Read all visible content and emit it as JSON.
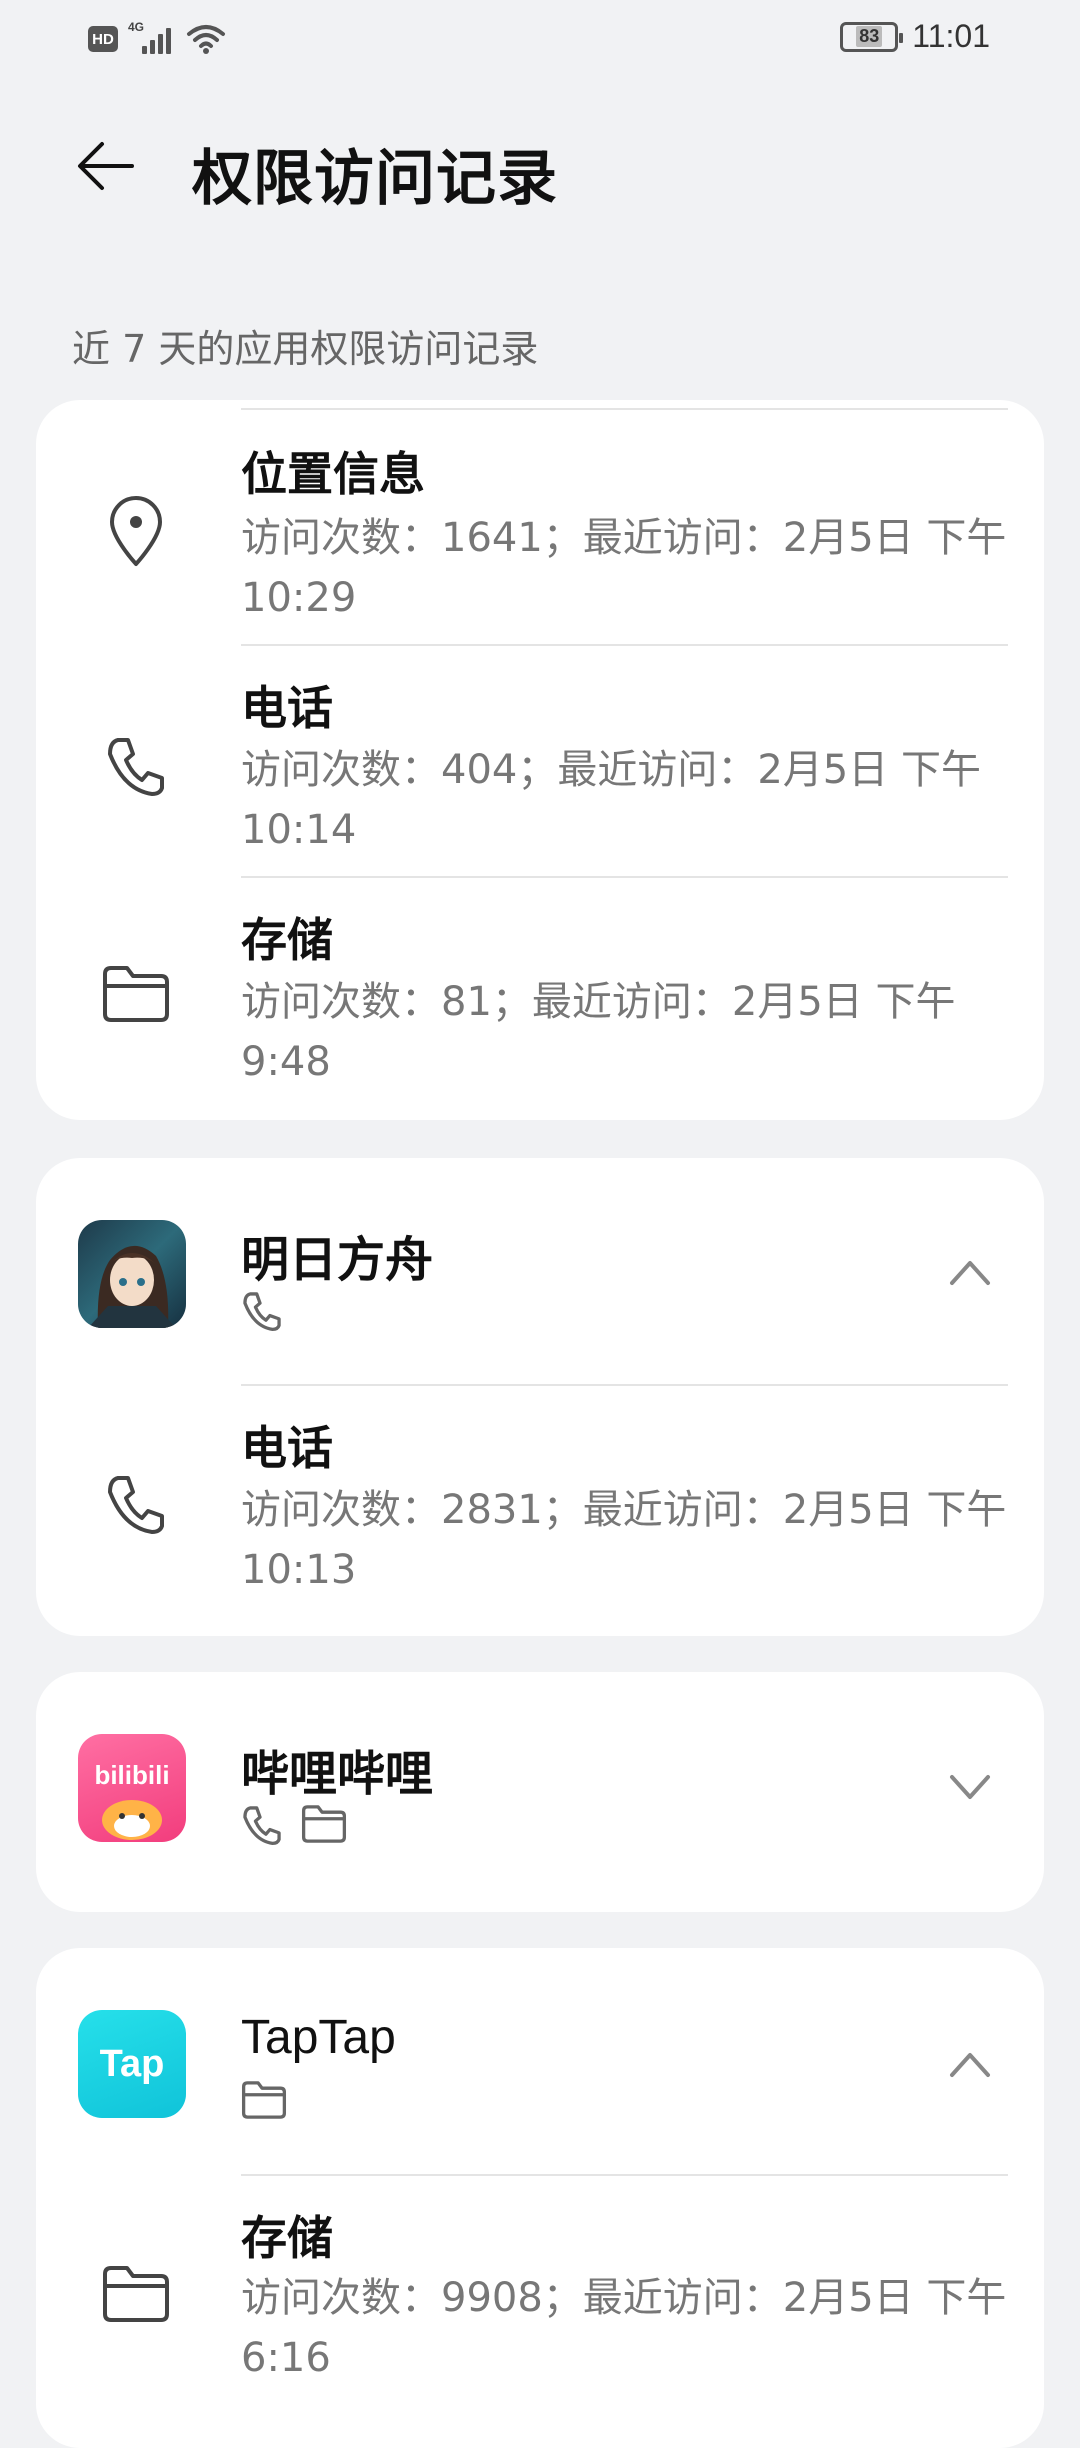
{
  "status_bar": {
    "hd": "HD",
    "network": "4G",
    "battery": "83",
    "time": "11:01"
  },
  "header": {
    "title": "权限访问记录"
  },
  "section_label": "近 7 天的应用权限访问记录",
  "top_card": {
    "rows": [
      {
        "icon": "location-pin-icon",
        "title": "位置信息",
        "desc": "访问次数：1641；最近访问：2月5日 下午10:29"
      },
      {
        "icon": "phone-icon",
        "title": "电话",
        "desc": "访问次数：404；最近访问：2月5日 下午10:14"
      },
      {
        "icon": "folder-icon",
        "title": "存储",
        "desc": "访问次数：81；最近访问：2月5日 下午9:48"
      }
    ]
  },
  "apps": [
    {
      "name": "明日方舟",
      "permission_icons": [
        "phone-icon"
      ],
      "expanded": true,
      "rows": [
        {
          "icon": "phone-icon",
          "title": "电话",
          "desc": "访问次数：2831；最近访问：2月5日 下午10:13"
        }
      ]
    },
    {
      "name": "哔哩哔哩",
      "icon_text": "bilibili",
      "permission_icons": [
        "phone-icon",
        "folder-icon"
      ],
      "expanded": false
    },
    {
      "name": "TapTap",
      "icon_text": "Tap",
      "permission_icons": [
        "folder-icon"
      ],
      "expanded": true,
      "rows": [
        {
          "icon": "folder-icon",
          "title": "存储",
          "desc": "访问次数：9908；最近访问：2月5日 下午6:16"
        }
      ]
    }
  ],
  "colors": {
    "background": "#f1f2f4",
    "card": "#ffffff",
    "secondary_text": "#777777",
    "bilibili_pink": "#f23d7d",
    "taptap_cyan": "#14c8dc"
  }
}
